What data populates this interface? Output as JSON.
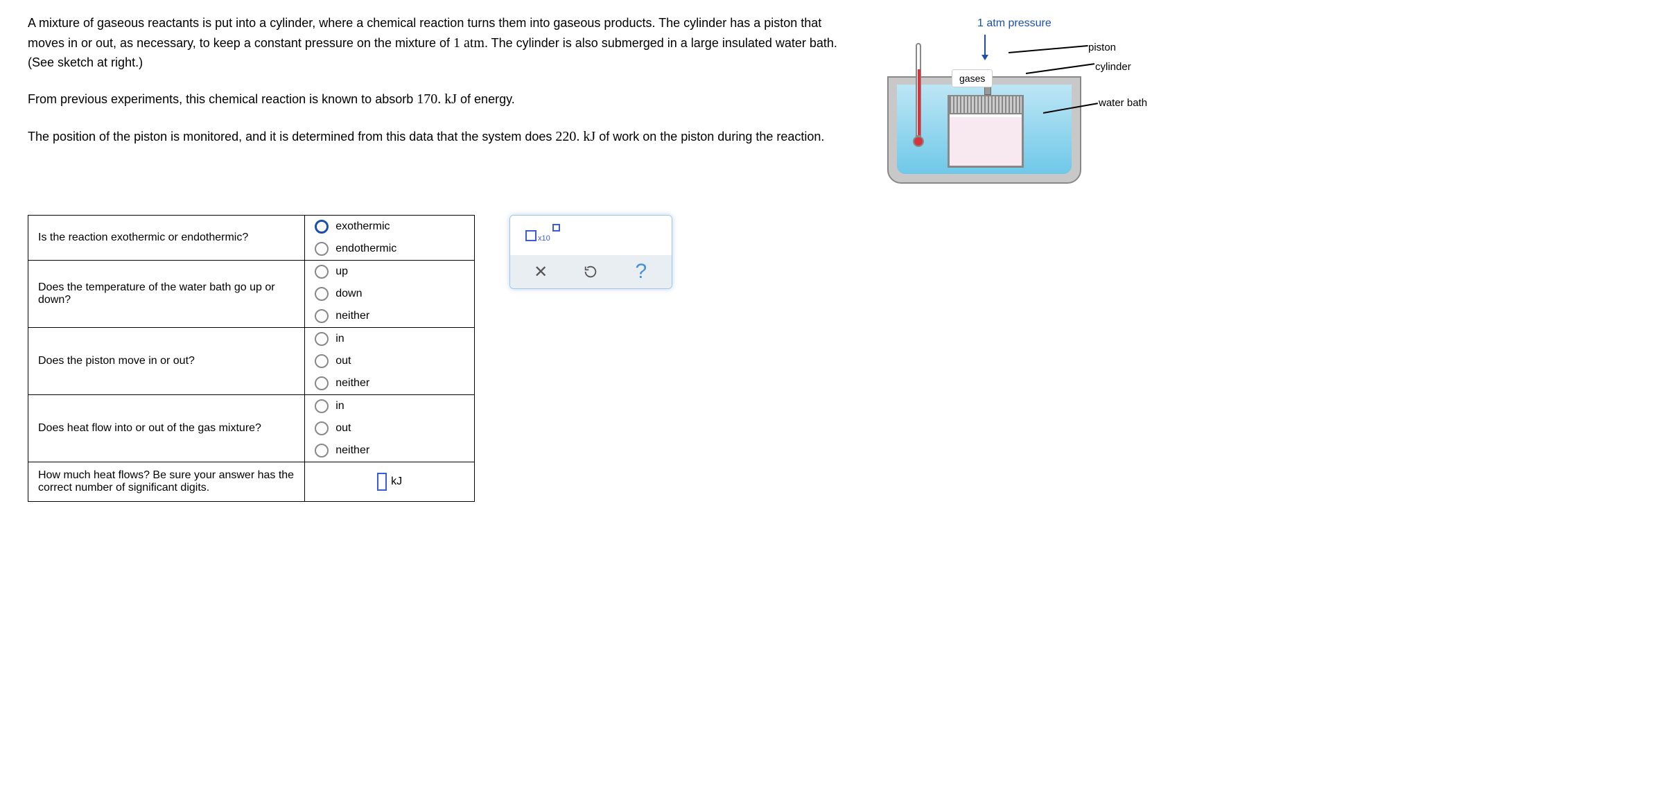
{
  "problem": {
    "para1_a": "A mixture of gaseous reactants is put into a cylinder, where a chemical reaction turns them into gaseous products. The cylinder has a piston that moves in or out, as necessary, to keep a constant pressure on the mixture of ",
    "atm": "1 atm",
    "para1_b": ". The cylinder is also submerged in a large insulated water bath. (See sketch at right.)",
    "para2_a": "From previous experiments, this chemical reaction is known to absorb ",
    "energy": "170. kJ",
    "para2_b": " of energy.",
    "para3_a": "The position of the piston is monitored, and it is determined from this data that the system does ",
    "work": "220. kJ",
    "para3_b": " of work on the piston during the reaction."
  },
  "diagram": {
    "pressure_label": "1 atm pressure",
    "piston": "piston",
    "cylinder": "cylinder",
    "water_bath": "water bath",
    "gases": "gases"
  },
  "questions": [
    {
      "text": "Is the reaction exothermic or endothermic?",
      "options": [
        "exothermic",
        "endothermic"
      ],
      "selected": 0
    },
    {
      "text": "Does the temperature of the water bath go up or down?",
      "options": [
        "up",
        "down",
        "neither"
      ],
      "selected": -1
    },
    {
      "text": "Does the piston move in or out?",
      "options": [
        "in",
        "out",
        "neither"
      ],
      "selected": -1
    },
    {
      "text": "Does heat flow into or out of the gas mixture?",
      "options": [
        "in",
        "out",
        "neither"
      ],
      "selected": -1
    }
  ],
  "heat_question": "How much heat flows? Be sure your answer has the correct number of significant digits.",
  "heat_unit": "kJ",
  "tool": {
    "x10": "x10"
  }
}
